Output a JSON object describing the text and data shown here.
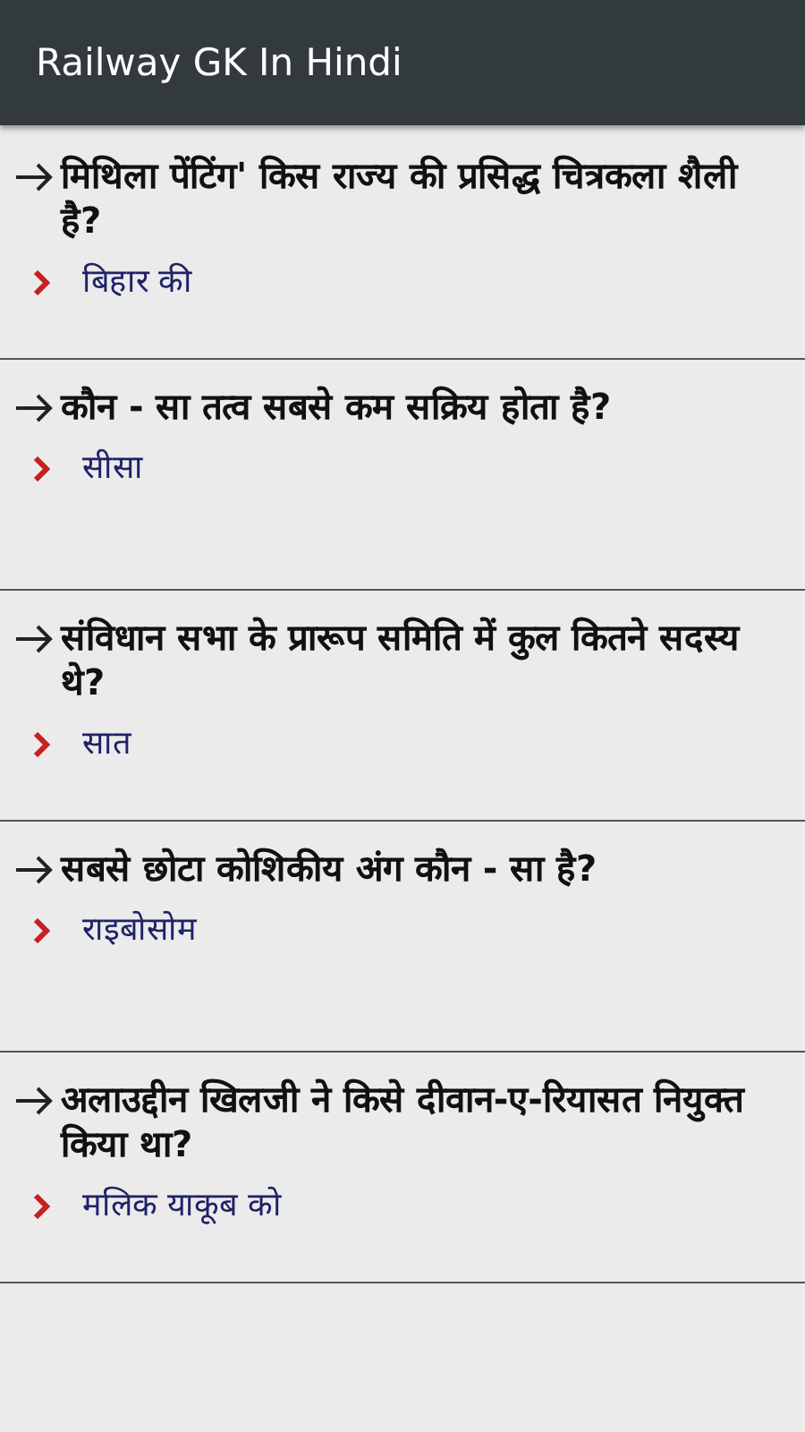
{
  "app_bar": {
    "title": "Railway GK In Hindi"
  },
  "cards": [
    {
      "question": "मिथिला पेंटिंग' किस राज्य की प्रसिद्ध चित्रकला शैली है?",
      "answer": "बिहार की"
    },
    {
      "question": "कौन - सा तत्व सबसे कम सक्रिय होता है?",
      "answer": "सीसा"
    },
    {
      "question": "संविधान सभा के प्रारूप समिति में कुल कितने सदस्य थे?",
      "answer": "सात"
    },
    {
      "question": "सबसे छोटा कोशिकीय अंग कौन - सा है?",
      "answer": "राइबोसोम"
    },
    {
      "question": "अलाउद्दीन खिलजी ने किसे दीवान-ए-रियासत नियुक्त किया था?",
      "answer": "मलिक याकूब को"
    }
  ]
}
